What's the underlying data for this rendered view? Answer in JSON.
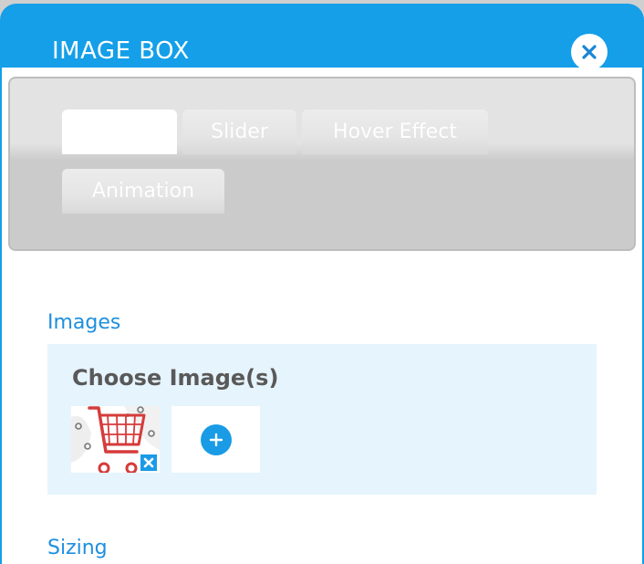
{
  "dialog": {
    "title": "IMAGE BOX",
    "close_icon": "close-icon",
    "accent_color": "#149fe8"
  },
  "tabs": [
    {
      "label": "",
      "active": true
    },
    {
      "label": "Slider",
      "active": false
    },
    {
      "label": "Hover Effect",
      "active": false
    },
    {
      "label": "Animation",
      "active": false
    }
  ],
  "sections": {
    "images": {
      "label": "Images",
      "choose_title": "Choose Image(s)",
      "thumbnail_icon": "shopping-cart-icon",
      "remove_icon": "close-icon",
      "add_icon": "plus-icon"
    },
    "sizing": {
      "label": "Sizing"
    }
  }
}
